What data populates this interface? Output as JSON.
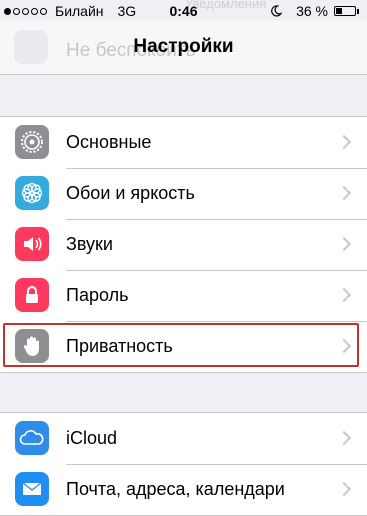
{
  "background_ghost": {
    "top_text": "Уведомления",
    "row_text": "Не беспокоить"
  },
  "status_bar": {
    "carrier": "Билайн",
    "network": "3G",
    "time": "0:46",
    "battery_text": "36 %",
    "battery_level": 0.36
  },
  "nav": {
    "title": "Настройки"
  },
  "group1": {
    "items": [
      {
        "label": "Основные",
        "icon": "gear-icon",
        "color": "#8e8e93"
      },
      {
        "label": "Обои и яркость",
        "icon": "flower-icon",
        "color": "#35aadc"
      },
      {
        "label": "Звуки",
        "icon": "speaker-icon",
        "color": "#fd3a5e"
      },
      {
        "label": "Пароль",
        "icon": "lock-icon",
        "color": "#fd3a5e"
      },
      {
        "label": "Приватность",
        "icon": "hand-icon",
        "color": "#8e8e93"
      }
    ]
  },
  "group2": {
    "items": [
      {
        "label": "iCloud",
        "icon": "cloud-icon",
        "color": "#2f8de8"
      },
      {
        "label": "Почта, адреса, календари",
        "icon": "mail-icon",
        "color": "#1f8ef3"
      }
    ]
  },
  "highlight_color": "#c0322a"
}
